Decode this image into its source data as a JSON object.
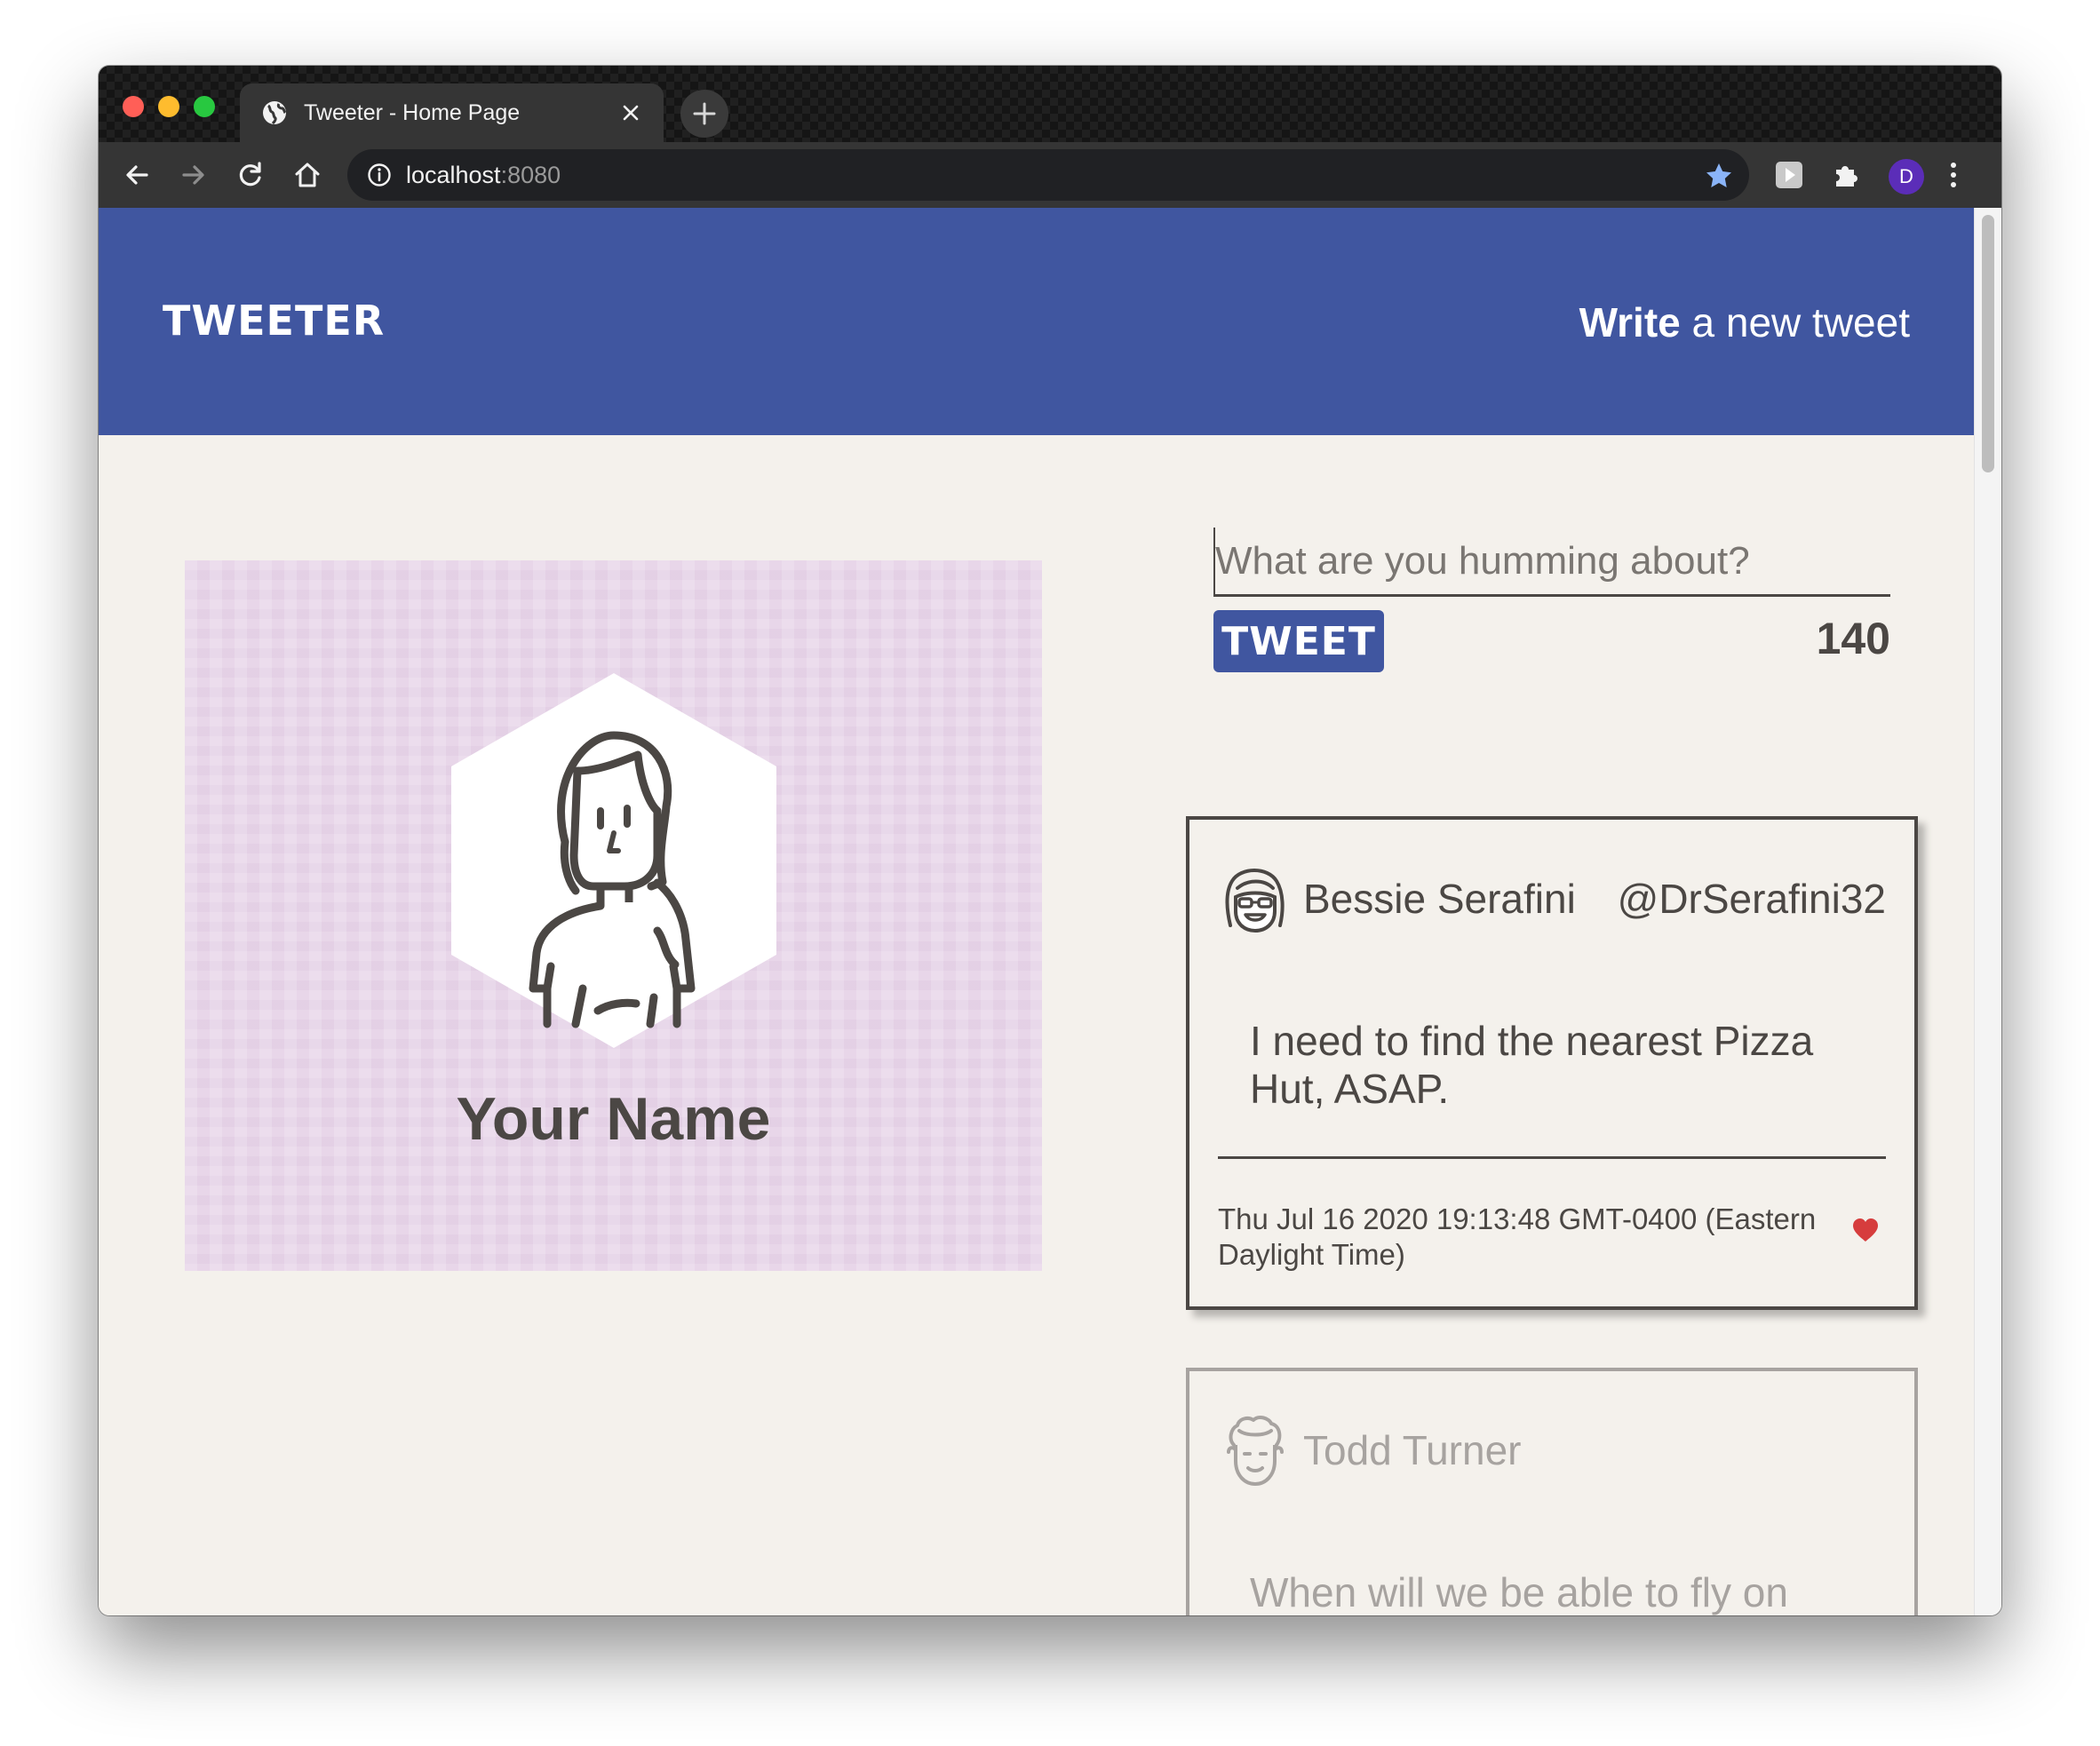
{
  "browser": {
    "tab_title": "Tweeter - Home Page",
    "url_host": "localhost",
    "url_port": ":8080",
    "profile_initial": "D"
  },
  "header": {
    "logo": "TWEETER",
    "compose_bold": "Write",
    "compose_rest": " a new tweet",
    "background_color": "#4056a0"
  },
  "profile": {
    "name": "Your Name"
  },
  "composer": {
    "placeholder": "What are you humming about?",
    "button_label": "TWEET",
    "char_count": "140"
  },
  "tweets": [
    {
      "author": "Bessie Serafini",
      "handle": "@DrSerafini32",
      "body": "I need to find the nearest Pizza Hut, ASAP.",
      "date": "Thu Jul 16 2020 19:13:48 GMT-0400 (Eastern Daylight Time)",
      "avatar_icon": "bessie-avatar-icon"
    },
    {
      "author": "Todd Turner",
      "body": "When will we be able to fly on planes again???",
      "avatar_icon": "todd-avatar-icon"
    }
  ],
  "colors": {
    "page_background": "#f4f1ec",
    "text": "#4b4744",
    "profile_background": "#e8d6e9",
    "like_heart": "#d63d3d"
  }
}
